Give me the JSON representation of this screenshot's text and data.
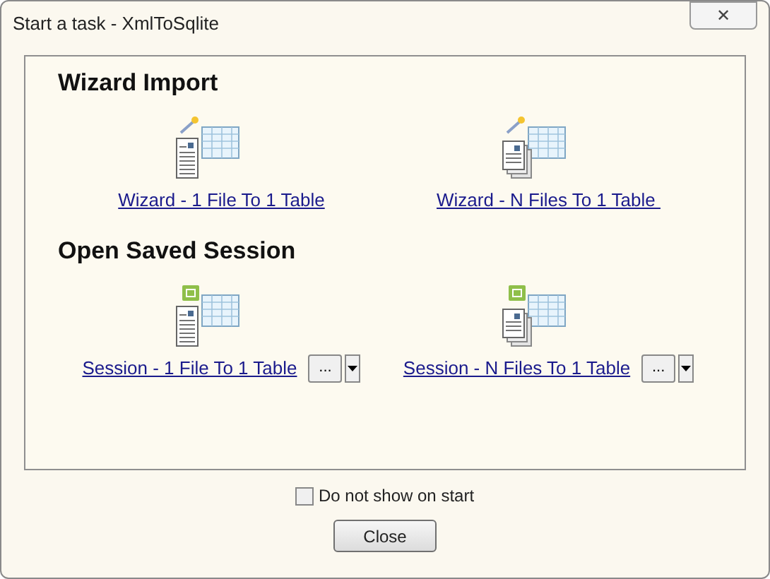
{
  "window": {
    "title": "Start a task - XmlToSqlite",
    "close": "✕"
  },
  "sections": [
    {
      "title": "Wizard Import",
      "items": [
        {
          "kind": "wizard",
          "label": "Wizard - 1 File To 1 Table"
        },
        {
          "kind": "wizard",
          "label": "Wizard - N Files To 1 Table "
        }
      ]
    },
    {
      "title": "Open Saved Session",
      "items": [
        {
          "kind": "session",
          "label": "Session - 1 File To 1 Table",
          "button": "..."
        },
        {
          "kind": "session",
          "label": "Session - N Files To 1 Table",
          "button": "..."
        }
      ]
    }
  ],
  "checkbox": {
    "label": "Do not show on start",
    "checked": false
  },
  "close_button": "Close"
}
